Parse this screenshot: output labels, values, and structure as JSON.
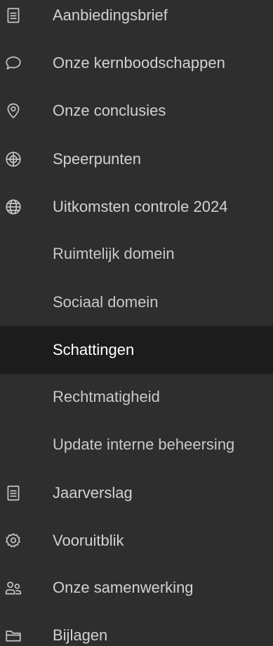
{
  "nav": {
    "items": [
      {
        "label": "Aanbiedingsbrief",
        "icon": "document-icon"
      },
      {
        "label": "Onze kernboodschappen",
        "icon": "speech-bubble-icon"
      },
      {
        "label": "Onze conclusies",
        "icon": "location-pin-icon"
      },
      {
        "label": "Speerpunten",
        "icon": "crosshair-icon"
      },
      {
        "label": "Uitkomsten controle 2024",
        "icon": "globe-icon"
      },
      {
        "label": "Ruimtelijk domein",
        "icon": ""
      },
      {
        "label": "Sociaal domein",
        "icon": ""
      },
      {
        "label": "Schattingen",
        "icon": "",
        "active": true
      },
      {
        "label": "Rechtmatigheid",
        "icon": ""
      },
      {
        "label": "Update interne beheersing",
        "icon": ""
      },
      {
        "label": "Jaarverslag",
        "icon": "document-icon"
      },
      {
        "label": "Vooruitblik",
        "icon": "gear-icon"
      },
      {
        "label": "Onze samenwerking",
        "icon": "people-icon"
      },
      {
        "label": "Bijlagen",
        "icon": "folder-icon"
      }
    ]
  }
}
